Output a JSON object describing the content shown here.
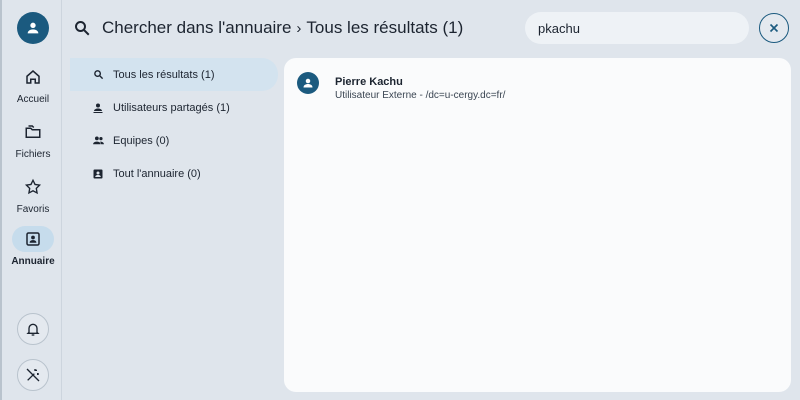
{
  "nav": {
    "items": [
      {
        "label": "Accueil",
        "icon": "home-icon"
      },
      {
        "label": "Fichiers",
        "icon": "folders-icon"
      },
      {
        "label": "Favoris",
        "icon": "star-icon"
      },
      {
        "label": "Annuaire",
        "icon": "contact-card-icon",
        "active": true
      }
    ]
  },
  "header": {
    "breadcrumb_root": "Chercher dans l'annuaire",
    "breadcrumb_current": "Tous les résultats (1)"
  },
  "search": {
    "value": "pkachu"
  },
  "filters": [
    {
      "label": "Tous les résultats (1)",
      "icon": "search-icon",
      "active": true
    },
    {
      "label": "Utilisateurs partagés (1)",
      "icon": "shared-user-icon"
    },
    {
      "label": "Equipes (0)",
      "icon": "group-icon"
    },
    {
      "label": "Tout l'annuaire (0)",
      "icon": "contact-card-icon"
    }
  ],
  "results": [
    {
      "name": "Pierre Kachu",
      "subtitle": "Utilisateur Externe - /dc=u-cergy.dc=fr/"
    }
  ],
  "colors": {
    "accent": "#1b5a7f",
    "active_bg": "#d3e3ef",
    "background": "#dfe5ec"
  }
}
